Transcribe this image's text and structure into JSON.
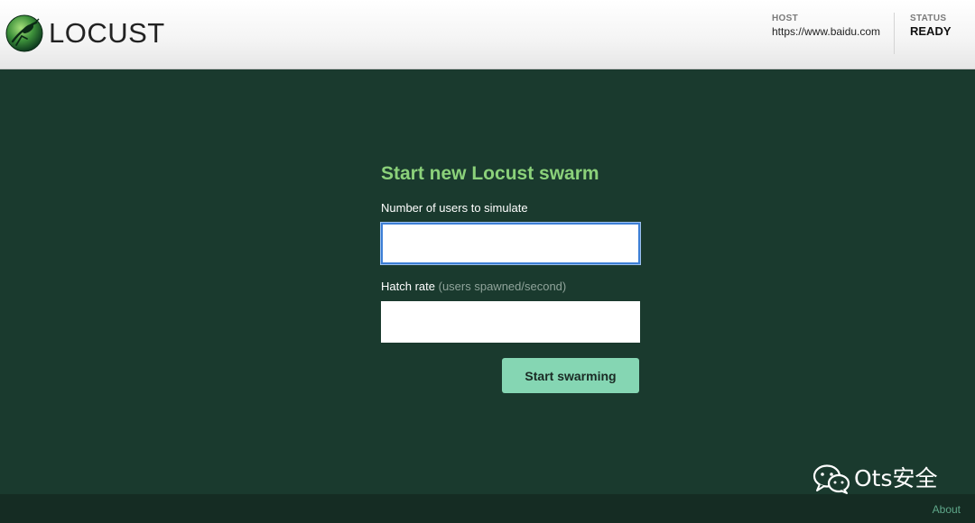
{
  "header": {
    "logo_text": "LOCUST",
    "host_label": "HOST",
    "host_value": "https://www.baidu.com",
    "status_label": "STATUS",
    "status_value": "READY"
  },
  "form": {
    "title": "Start new Locust swarm",
    "users_label": "Number of users to simulate",
    "users_value": "",
    "hatch_label": "Hatch rate",
    "hatch_hint": "(users spawned/second)",
    "hatch_value": "",
    "submit_label": "Start swarming"
  },
  "footer": {
    "about_label": "About"
  },
  "watermark": {
    "icon": "wechat-icon",
    "text": "Ots安全"
  },
  "colors": {
    "background": "#1a3a2e",
    "footer_background": "#152c23",
    "title_green": "#8bd17a",
    "button_green": "#85d6b3",
    "focus_blue": "#3d7fd6",
    "about_link": "#5fa88a"
  }
}
